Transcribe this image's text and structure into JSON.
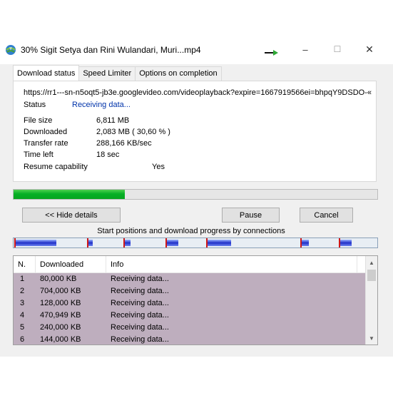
{
  "window": {
    "title": "30% Sigit Setya dan Rini Wulandari, Muri...mp4",
    "app_icon": "globe-download-icon",
    "controls": {
      "minimize": "–",
      "maximize": "☐",
      "close": "✕"
    }
  },
  "tabs": [
    {
      "label": "Download status"
    },
    {
      "label": "Speed Limiter"
    },
    {
      "label": "Options on completion"
    }
  ],
  "status": {
    "url": "https://rr1---sn-n5oqt5-jb3e.googlevideo.com/videoplayback?expire=1667919566ei=bhpqY9DSDO-«",
    "status_label": "Status",
    "status_value": "Receiving data...",
    "file_size_label": "File size",
    "file_size_value": "6,811  MB",
    "downloaded_label": "Downloaded",
    "downloaded_value": "2,083  MB  ( 30,60 % )",
    "transfer_rate_label": "Transfer rate",
    "transfer_rate_value": "288,166  KB/sec",
    "time_left_label": "Time left",
    "time_left_value": "18 sec",
    "resume_label": "Resume capability",
    "resume_value": "Yes"
  },
  "progress": {
    "percent": 30.6,
    "color": "#06b025"
  },
  "buttons": {
    "hide_details": "<< Hide details",
    "pause": "Pause",
    "cancel": "Cancel"
  },
  "connections_label": "Start positions and download progress by connections",
  "connections": {
    "columns": [
      "N.",
      "Downloaded",
      "Info"
    ],
    "rows": [
      {
        "n": "1",
        "downloaded": "80,000  KB",
        "info": "Receiving data..."
      },
      {
        "n": "2",
        "downloaded": "704,000  KB",
        "info": "Receiving data..."
      },
      {
        "n": "3",
        "downloaded": "128,000  KB",
        "info": "Receiving data..."
      },
      {
        "n": "4",
        "downloaded": "470,949  KB",
        "info": "Receiving data..."
      },
      {
        "n": "5",
        "downloaded": "240,000  KB",
        "info": "Receiving data..."
      },
      {
        "n": "6",
        "downloaded": "144,000  KB",
        "info": "Receiving data..."
      }
    ]
  },
  "colors": {
    "row_highlight": "#beaebe",
    "status_text": "#0033aa",
    "segment_fill": "#2030c8",
    "segment_marker": "#d01818"
  }
}
